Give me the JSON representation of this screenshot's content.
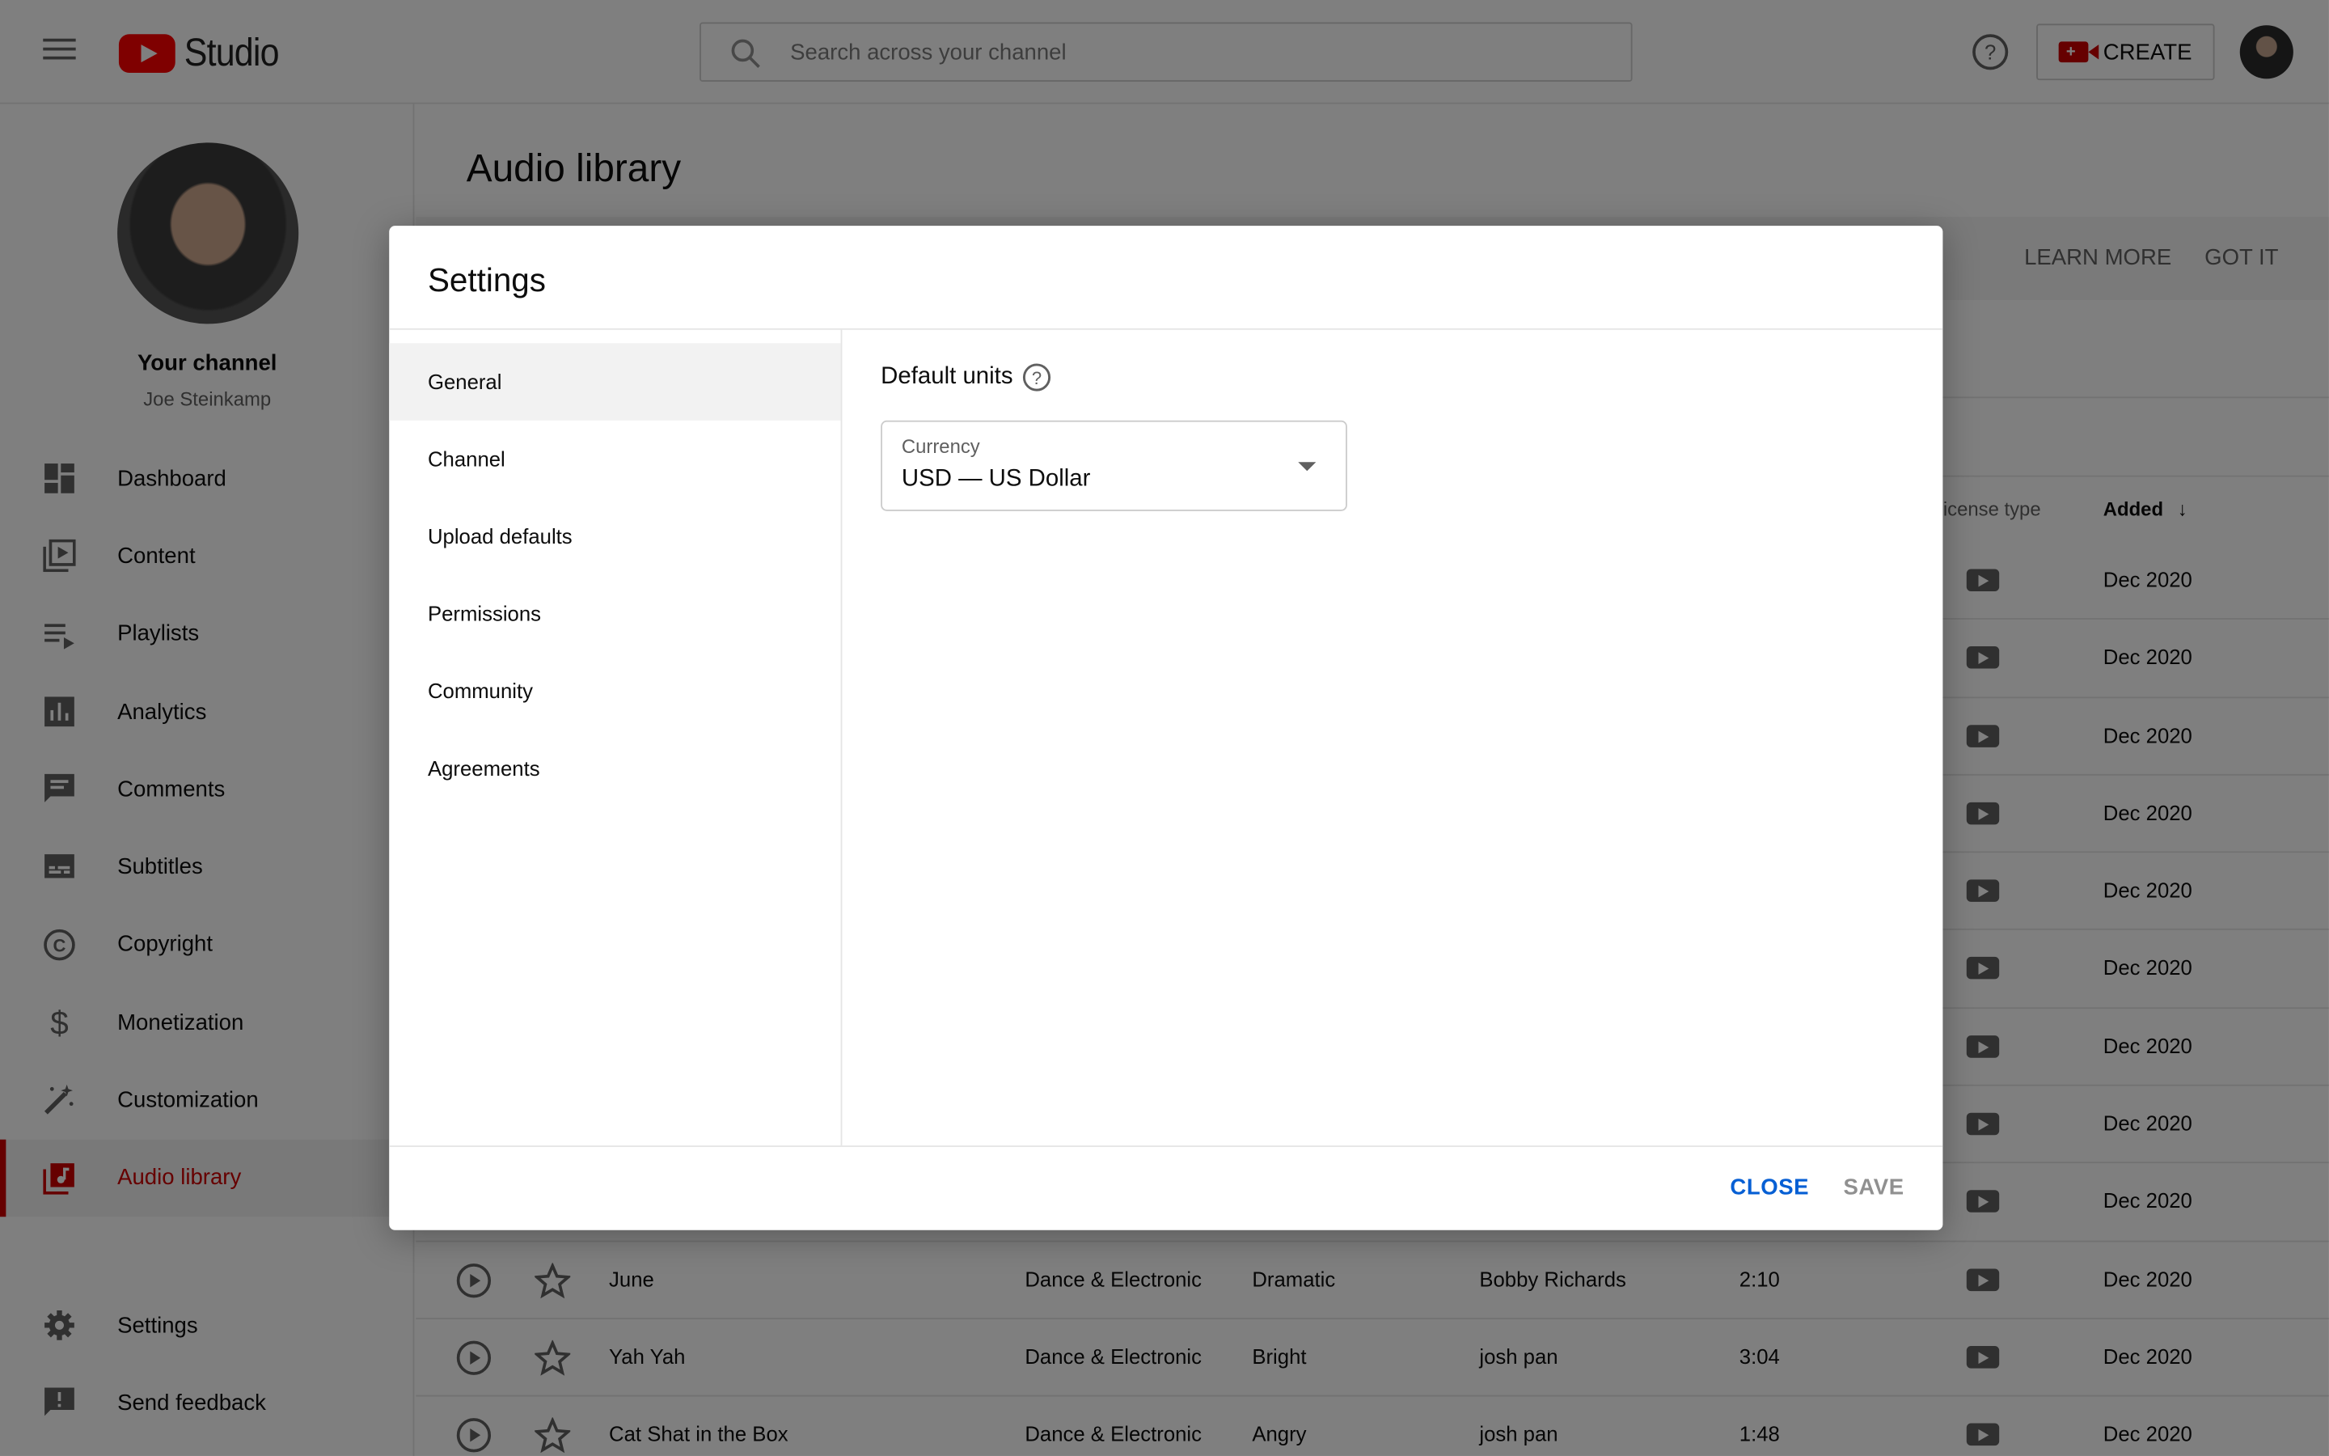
{
  "header": {
    "logo_text": "Studio",
    "search_placeholder": "Search across your channel",
    "create_label": "CREATE"
  },
  "sidebar": {
    "channel_title": "Your channel",
    "channel_name": "Joe Steinkamp",
    "items": [
      {
        "label": "Dashboard",
        "icon": "dashboard-icon"
      },
      {
        "label": "Content",
        "icon": "content-icon"
      },
      {
        "label": "Playlists",
        "icon": "playlists-icon"
      },
      {
        "label": "Analytics",
        "icon": "analytics-icon"
      },
      {
        "label": "Comments",
        "icon": "comments-icon"
      },
      {
        "label": "Subtitles",
        "icon": "subtitles-icon"
      },
      {
        "label": "Copyright",
        "icon": "copyright-icon"
      },
      {
        "label": "Monetization",
        "icon": "monetization-icon"
      },
      {
        "label": "Customization",
        "icon": "customization-icon"
      },
      {
        "label": "Audio library",
        "icon": "audio-library-icon",
        "active": true
      }
    ],
    "bottom_items": [
      {
        "label": "Settings",
        "icon": "gear-icon"
      },
      {
        "label": "Send feedback",
        "icon": "feedback-icon"
      }
    ]
  },
  "main": {
    "page_title": "Audio library",
    "banner": {
      "learn_more": "LEARN MORE",
      "got_it": "GOT IT"
    },
    "columns": {
      "license_type": "License type",
      "added": "Added"
    },
    "rows": [
      {
        "title": "",
        "genre": "",
        "mood": "",
        "artist": "",
        "duration": "",
        "added": "Dec 2020"
      },
      {
        "title": "",
        "genre": "",
        "mood": "",
        "artist": "",
        "duration": "",
        "added": "Dec 2020"
      },
      {
        "title": "",
        "genre": "",
        "mood": "",
        "artist": "",
        "duration": "",
        "added": "Dec 2020"
      },
      {
        "title": "",
        "genre": "",
        "mood": "",
        "artist": "",
        "duration": "",
        "added": "Dec 2020"
      },
      {
        "title": "",
        "genre": "",
        "mood": "",
        "artist": "",
        "duration": "",
        "added": "Dec 2020"
      },
      {
        "title": "",
        "genre": "",
        "mood": "",
        "artist": "",
        "duration": "",
        "added": "Dec 2020"
      },
      {
        "title": "",
        "genre": "",
        "mood": "",
        "artist": "",
        "duration": "",
        "added": "Dec 2020"
      },
      {
        "title": "",
        "genre": "",
        "mood": "",
        "artist": "",
        "duration": "",
        "added": "Dec 2020"
      },
      {
        "title": "",
        "genre": "",
        "mood": "",
        "artist": "",
        "duration": "",
        "added": "Dec 2020"
      },
      {
        "title": "June",
        "genre": "Dance & Electronic",
        "mood": "Dramatic",
        "artist": "Bobby Richards",
        "duration": "2:10",
        "added": "Dec 2020"
      },
      {
        "title": "Yah Yah",
        "genre": "Dance & Electronic",
        "mood": "Bright",
        "artist": "josh pan",
        "duration": "3:04",
        "added": "Dec 2020"
      },
      {
        "title": "Cat Shat in the Box",
        "genre": "Dance & Electronic",
        "mood": "Angry",
        "artist": "josh pan",
        "duration": "1:48",
        "added": "Dec 2020"
      }
    ]
  },
  "dialog": {
    "title": "Settings",
    "nav": [
      "General",
      "Channel",
      "Upload defaults",
      "Permissions",
      "Community",
      "Agreements"
    ],
    "active_nav": "General",
    "section_title": "Default units",
    "currency": {
      "label": "Currency",
      "value": "USD — US Dollar"
    },
    "close_label": "CLOSE",
    "save_label": "SAVE"
  },
  "colors": {
    "brand_red": "#ff0000",
    "accent_blue": "#065fd4",
    "active_red": "#cc0000"
  }
}
